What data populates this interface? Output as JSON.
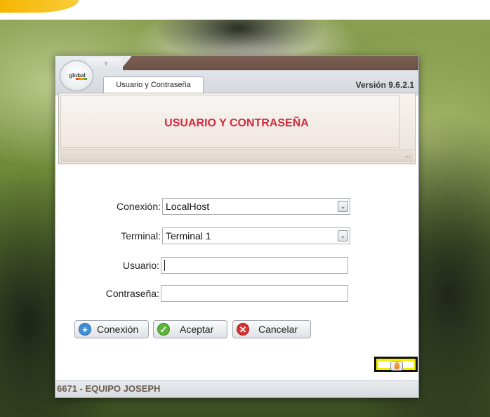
{
  "window": {
    "tab_label": "Usuario y Contraseña",
    "version": "Versión 9.6.2.1",
    "app_logo": "global",
    "qat_arrow": "▿"
  },
  "ribbon": {
    "title": "USUARIO Y CONTRASEÑA",
    "dots": "..."
  },
  "form": {
    "conexion_label": "Conexión:",
    "conexion_value": "LocalHost",
    "terminal_label": "Terminal:",
    "terminal_value": "Terminal 1",
    "usuario_label": "Usuario:",
    "usuario_value": "",
    "contrasena_label": "Contraseña:",
    "contrasena_value": "",
    "dropdown_arrow": "⌄"
  },
  "buttons": {
    "conexion": "Conexión",
    "aceptar": "Aceptar",
    "cancelar": "Cancelar",
    "conexion_icon": "+",
    "aceptar_icon": "✓",
    "cancelar_icon": "✕"
  },
  "status": {
    "text": "6671 - EQUIPO JOSEPH"
  },
  "colors": {
    "title_accent": "#d32a3d",
    "status_text": "#6a5a52",
    "highlight": "#f2ee00"
  }
}
